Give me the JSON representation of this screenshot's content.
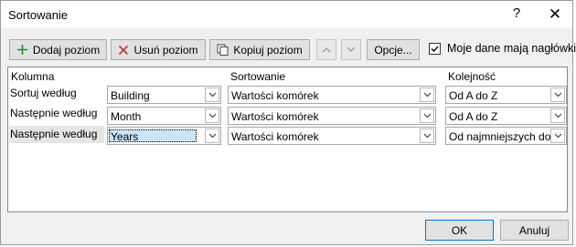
{
  "window": {
    "title": "Sortowanie"
  },
  "toolbar": {
    "add_level": "Dodaj poziom",
    "delete_level": "Usuń poziom",
    "copy_level": "Kopiuj poziom",
    "options": "Opcje...",
    "headers_checkbox_label": "Moje dane mają nagłówki",
    "headers_checked": true
  },
  "columns": {
    "column": "Kolumna",
    "sort_on": "Sortowanie",
    "order": "Kolejność"
  },
  "rows": [
    {
      "label": "Sortuj według",
      "column": "Building",
      "sort_on": "Wartości komórek",
      "order": "Od A do Z"
    },
    {
      "label": "Następnie według",
      "column": "Month",
      "sort_on": "Wartości komórek",
      "order": "Od A do Z"
    },
    {
      "label": "Następnie według",
      "column": "Years",
      "sort_on": "Wartości komórek",
      "order": "Od najmniejszych do"
    }
  ],
  "footer": {
    "ok": "OK",
    "cancel": "Anuluj"
  },
  "icons": {
    "add": "plus-icon",
    "delete": "x-icon",
    "copy": "copy-icon",
    "up": "arrow-up-icon",
    "down": "arrow-down-icon",
    "help": "help-icon",
    "close": "close-icon",
    "dropdown": "chevron-down-icon"
  },
  "colors": {
    "add_icon": "#1e8c3a",
    "delete_icon": "#c0392b",
    "selection": "#cce4f7"
  }
}
